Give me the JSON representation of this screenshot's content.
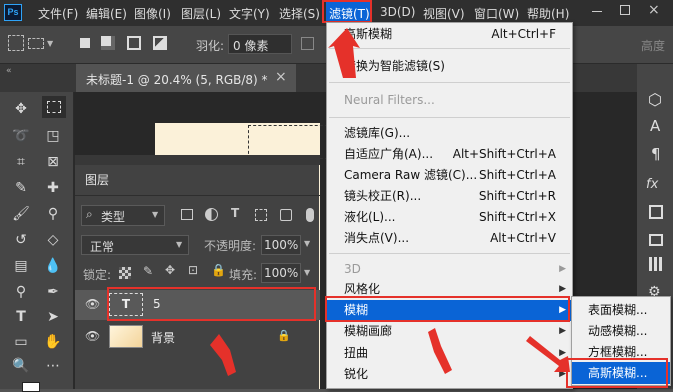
{
  "menubar": {
    "logo": "Ps",
    "items": [
      "文件(F)",
      "编辑(E)",
      "图像(I)",
      "图层(L)",
      "文字(Y)",
      "选择(S)",
      "滤镜(T)",
      "3D(D)",
      "视图(V)",
      "窗口(W)",
      "帮助(H)"
    ]
  },
  "options": {
    "feather_label": "羽化:",
    "feather_value": "0 像素",
    "right_label": "高度"
  },
  "document_tab": {
    "title": "未标题-1 @ 20.4% (5, RGB/8) *",
    "close": "×"
  },
  "filter_menu": {
    "items": [
      {
        "label": "高斯模糊",
        "shortcut": "Alt+Ctrl+F"
      },
      {
        "label": "转换为智能滤镜(S)",
        "shortcut": ""
      },
      {
        "label": "Neural Filters...",
        "shortcut": "",
        "disabled": true
      },
      {
        "label": "滤镜库(G)...",
        "shortcut": ""
      },
      {
        "label": "自适应广角(A)...",
        "shortcut": "Alt+Shift+Ctrl+A"
      },
      {
        "label": "Camera Raw 滤镜(C)...",
        "shortcut": "Shift+Ctrl+A"
      },
      {
        "label": "镜头校正(R)...",
        "shortcut": "Shift+Ctrl+R"
      },
      {
        "label": "液化(L)...",
        "shortcut": "Shift+Ctrl+X"
      },
      {
        "label": "消失点(V)...",
        "shortcut": "Alt+Ctrl+V"
      },
      {
        "label": "3D",
        "shortcut": "",
        "disabled": true,
        "submenu": true
      },
      {
        "label": "风格化",
        "shortcut": "",
        "submenu": true
      },
      {
        "label": "模糊",
        "shortcut": "",
        "submenu": true,
        "highlighted": true
      },
      {
        "label": "模糊画廊",
        "shortcut": "",
        "submenu": true
      },
      {
        "label": "扭曲",
        "shortcut": "",
        "submenu": true
      },
      {
        "label": "锐化",
        "shortcut": "",
        "submenu": true
      }
    ]
  },
  "blur_submenu": {
    "items": [
      "表面模糊...",
      "动感模糊...",
      "方框模糊...",
      "高斯模糊..."
    ],
    "highlighted_index": 3
  },
  "layers_panel": {
    "tab": "图层",
    "kind_filter": "类型",
    "blend_mode": "正常",
    "opacity_label": "不透明度:",
    "opacity_value": "100%",
    "lock_label": "锁定:",
    "fill_label": "填充:",
    "fill_value": "100%",
    "layers": [
      {
        "name": "5",
        "type": "text",
        "selected": true
      },
      {
        "name": "背景",
        "type": "image",
        "locked": true
      }
    ]
  },
  "colors": {
    "accent_blue": "#0a64d6",
    "annotation_red": "#e5312a"
  }
}
